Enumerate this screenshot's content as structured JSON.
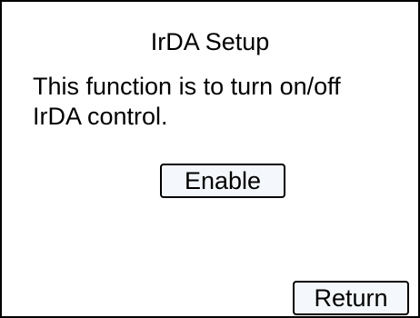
{
  "dialog": {
    "title": "IrDA Setup",
    "description_lines": [
      "This function is to turn on/off",
      "IrDA control."
    ],
    "enable_label": "Enable",
    "return_label": "Return"
  }
}
